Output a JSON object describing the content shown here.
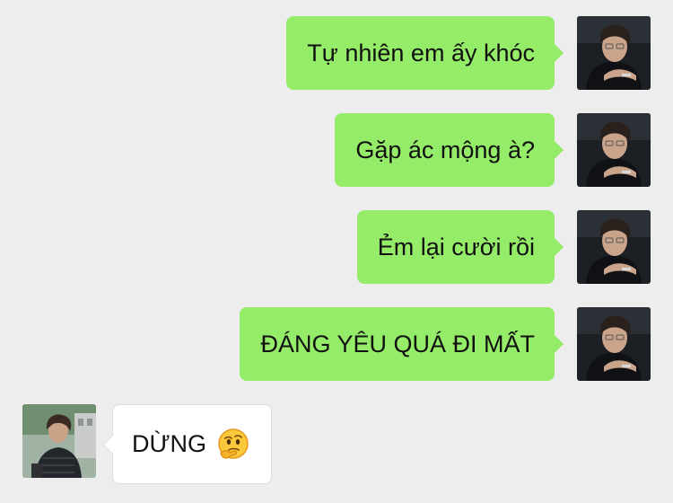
{
  "conversation": {
    "messages": [
      {
        "sender": "me",
        "text": "Tự nhiên em ấy khóc",
        "avatar_icon": "male-portrait-avatar"
      },
      {
        "sender": "me",
        "text": "Gặp ác mộng à?",
        "avatar_icon": "male-portrait-avatar"
      },
      {
        "sender": "me",
        "text": "Ẻm lại cười rồi",
        "avatar_icon": "male-portrait-avatar"
      },
      {
        "sender": "me",
        "text": "ĐÁNG YÊU QUÁ ĐI MẤT",
        "avatar_icon": "male-portrait-avatar"
      },
      {
        "sender": "other",
        "text": "DỪNG",
        "emoji_icon": "thinking-face-icon",
        "avatar_icon": "male-street-avatar"
      }
    ]
  },
  "colors": {
    "background": "#ededed",
    "outgoing_bubble": "#95ec69",
    "incoming_bubble": "#ffffff"
  }
}
